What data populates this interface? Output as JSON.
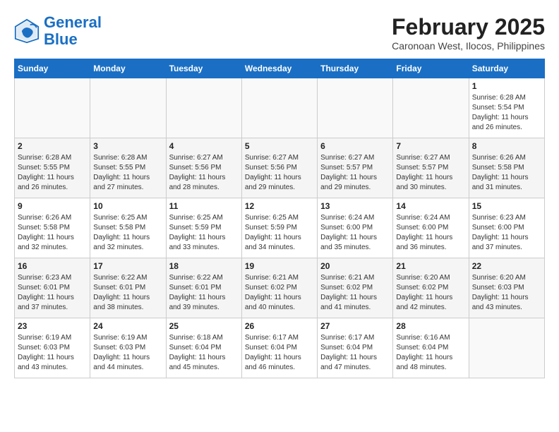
{
  "header": {
    "logo_line1": "General",
    "logo_line2": "Blue",
    "title": "February 2025",
    "subtitle": "Caronoan West, Ilocos, Philippines"
  },
  "days_of_week": [
    "Sunday",
    "Monday",
    "Tuesday",
    "Wednesday",
    "Thursday",
    "Friday",
    "Saturday"
  ],
  "weeks": [
    [
      {
        "day": "",
        "info": ""
      },
      {
        "day": "",
        "info": ""
      },
      {
        "day": "",
        "info": ""
      },
      {
        "day": "",
        "info": ""
      },
      {
        "day": "",
        "info": ""
      },
      {
        "day": "",
        "info": ""
      },
      {
        "day": "1",
        "info": "Sunrise: 6:28 AM\nSunset: 5:54 PM\nDaylight: 11 hours and 26 minutes."
      }
    ],
    [
      {
        "day": "2",
        "info": "Sunrise: 6:28 AM\nSunset: 5:55 PM\nDaylight: 11 hours and 26 minutes."
      },
      {
        "day": "3",
        "info": "Sunrise: 6:28 AM\nSunset: 5:55 PM\nDaylight: 11 hours and 27 minutes."
      },
      {
        "day": "4",
        "info": "Sunrise: 6:27 AM\nSunset: 5:56 PM\nDaylight: 11 hours and 28 minutes."
      },
      {
        "day": "5",
        "info": "Sunrise: 6:27 AM\nSunset: 5:56 PM\nDaylight: 11 hours and 29 minutes."
      },
      {
        "day": "6",
        "info": "Sunrise: 6:27 AM\nSunset: 5:57 PM\nDaylight: 11 hours and 29 minutes."
      },
      {
        "day": "7",
        "info": "Sunrise: 6:27 AM\nSunset: 5:57 PM\nDaylight: 11 hours and 30 minutes."
      },
      {
        "day": "8",
        "info": "Sunrise: 6:26 AM\nSunset: 5:58 PM\nDaylight: 11 hours and 31 minutes."
      }
    ],
    [
      {
        "day": "9",
        "info": "Sunrise: 6:26 AM\nSunset: 5:58 PM\nDaylight: 11 hours and 32 minutes."
      },
      {
        "day": "10",
        "info": "Sunrise: 6:25 AM\nSunset: 5:58 PM\nDaylight: 11 hours and 32 minutes."
      },
      {
        "day": "11",
        "info": "Sunrise: 6:25 AM\nSunset: 5:59 PM\nDaylight: 11 hours and 33 minutes."
      },
      {
        "day": "12",
        "info": "Sunrise: 6:25 AM\nSunset: 5:59 PM\nDaylight: 11 hours and 34 minutes."
      },
      {
        "day": "13",
        "info": "Sunrise: 6:24 AM\nSunset: 6:00 PM\nDaylight: 11 hours and 35 minutes."
      },
      {
        "day": "14",
        "info": "Sunrise: 6:24 AM\nSunset: 6:00 PM\nDaylight: 11 hours and 36 minutes."
      },
      {
        "day": "15",
        "info": "Sunrise: 6:23 AM\nSunset: 6:00 PM\nDaylight: 11 hours and 37 minutes."
      }
    ],
    [
      {
        "day": "16",
        "info": "Sunrise: 6:23 AM\nSunset: 6:01 PM\nDaylight: 11 hours and 37 minutes."
      },
      {
        "day": "17",
        "info": "Sunrise: 6:22 AM\nSunset: 6:01 PM\nDaylight: 11 hours and 38 minutes."
      },
      {
        "day": "18",
        "info": "Sunrise: 6:22 AM\nSunset: 6:01 PM\nDaylight: 11 hours and 39 minutes."
      },
      {
        "day": "19",
        "info": "Sunrise: 6:21 AM\nSunset: 6:02 PM\nDaylight: 11 hours and 40 minutes."
      },
      {
        "day": "20",
        "info": "Sunrise: 6:21 AM\nSunset: 6:02 PM\nDaylight: 11 hours and 41 minutes."
      },
      {
        "day": "21",
        "info": "Sunrise: 6:20 AM\nSunset: 6:02 PM\nDaylight: 11 hours and 42 minutes."
      },
      {
        "day": "22",
        "info": "Sunrise: 6:20 AM\nSunset: 6:03 PM\nDaylight: 11 hours and 43 minutes."
      }
    ],
    [
      {
        "day": "23",
        "info": "Sunrise: 6:19 AM\nSunset: 6:03 PM\nDaylight: 11 hours and 43 minutes."
      },
      {
        "day": "24",
        "info": "Sunrise: 6:19 AM\nSunset: 6:03 PM\nDaylight: 11 hours and 44 minutes."
      },
      {
        "day": "25",
        "info": "Sunrise: 6:18 AM\nSunset: 6:04 PM\nDaylight: 11 hours and 45 minutes."
      },
      {
        "day": "26",
        "info": "Sunrise: 6:17 AM\nSunset: 6:04 PM\nDaylight: 11 hours and 46 minutes."
      },
      {
        "day": "27",
        "info": "Sunrise: 6:17 AM\nSunset: 6:04 PM\nDaylight: 11 hours and 47 minutes."
      },
      {
        "day": "28",
        "info": "Sunrise: 6:16 AM\nSunset: 6:04 PM\nDaylight: 11 hours and 48 minutes."
      },
      {
        "day": "",
        "info": ""
      }
    ]
  ]
}
